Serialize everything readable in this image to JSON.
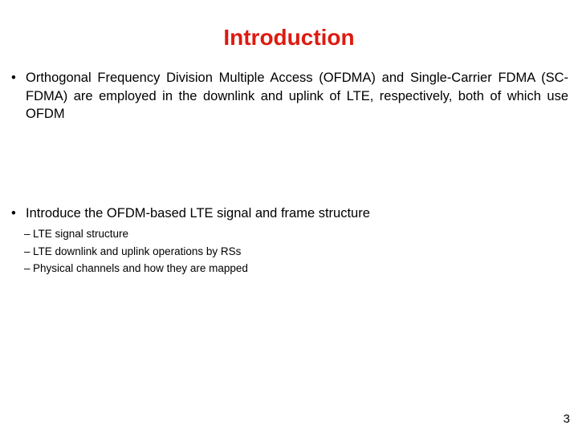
{
  "slide": {
    "title": "Introduction",
    "title_color": "#dd1a11",
    "background_color": "#ffffff",
    "page_number": "3"
  },
  "bullets": [
    {
      "marker": "•",
      "text": "Orthogonal Frequency Division Multiple Access (OFDMA) and Single-Carrier FDMA (SC-FDMA) are employed in the downlink and uplink of LTE, respectively, both of which use OFDM"
    },
    {
      "marker": "•",
      "text": "Introduce the OFDM-based LTE signal and frame structure"
    }
  ],
  "sub_bullets": [
    {
      "marker": "–",
      "text": "LTE signal structure"
    },
    {
      "marker": "–",
      "text": "LTE downlink and uplink operations by RSs"
    },
    {
      "marker": "–",
      "text": "Physical channels and how they are mapped"
    }
  ]
}
